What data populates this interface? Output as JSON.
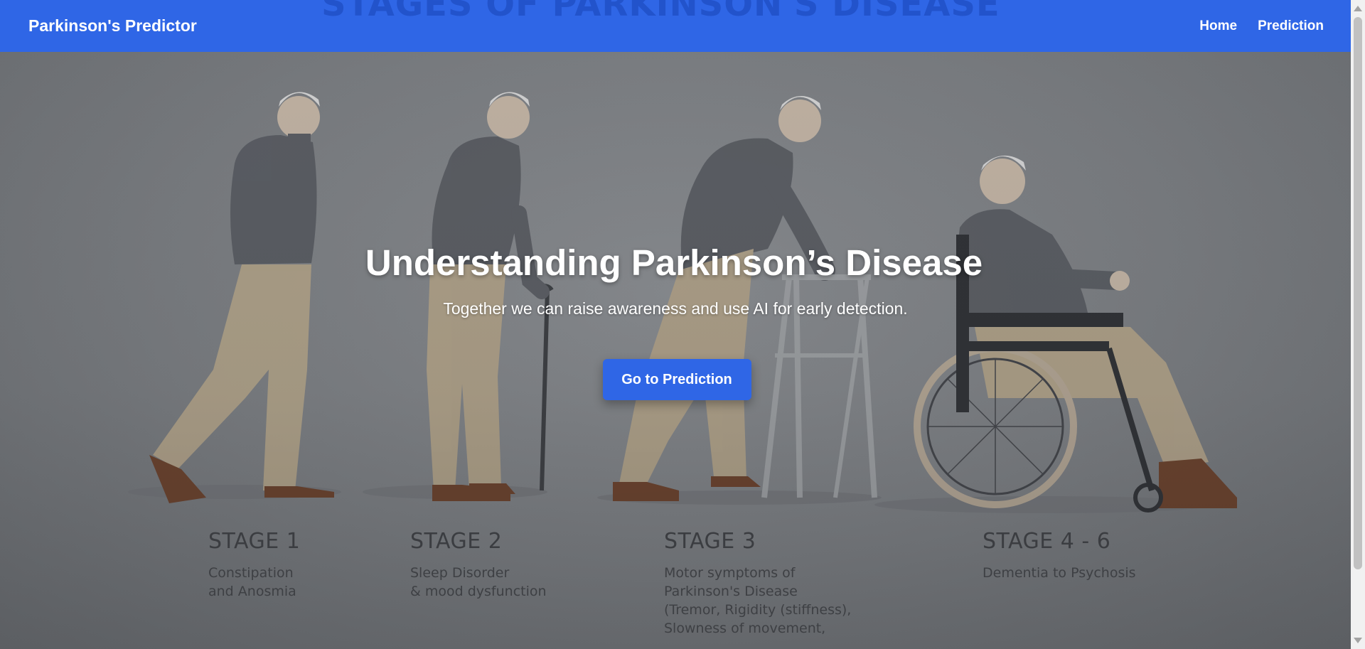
{
  "navbar": {
    "brand": "Parkinson's Predictor",
    "ghost_heading": "STAGES OF PARKINSON'S DISEASE",
    "links": [
      {
        "label": "Home"
      },
      {
        "label": "Prediction"
      }
    ]
  },
  "hero": {
    "title": "Understanding Parkinson’s Disease",
    "subtitle": "Together we can raise awareness and use AI for early detection.",
    "cta_label": "Go to Prediction"
  },
  "stages": [
    {
      "title": "STAGE 1",
      "desc": "Constipation\nand Anosmia"
    },
    {
      "title": "STAGE 2",
      "desc": "Sleep Disorder\n& mood dysfunction"
    },
    {
      "title": "STAGE 3",
      "desc": "Motor symptoms of\nParkinson's Disease\n(Tremor, Rigidity (stiffness),\nSlowness of movement,"
    },
    {
      "title": "STAGE 4 - 6",
      "desc": "Dementia to Psychosis"
    }
  ],
  "colors": {
    "navbar": "#2f66e6",
    "button": "#2f66e6",
    "hero_bg": "#7d8084",
    "sweater": "#5a5d63",
    "trousers": "#b3a48a",
    "shoes": "#6b3f28",
    "hair": "#dcdcdc"
  }
}
